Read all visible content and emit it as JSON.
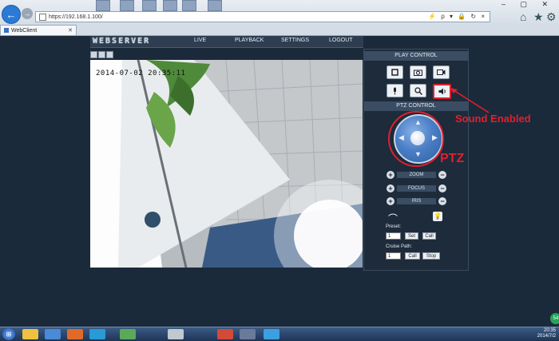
{
  "browser": {
    "url": "https://192.168.1.100/",
    "tab_title": "WebClient",
    "addr_tools": "⚡ ρ ▾ 🔒 ↻ ×",
    "window_controls": "– ▢ ✕"
  },
  "app": {
    "brand": "WEBSERVER",
    "menu": [
      "LIVE",
      "PLAYBACK",
      "SETTINGS",
      "LOGOUT"
    ]
  },
  "video": {
    "timestamp": "2014-07-02 20:35:11"
  },
  "panel": {
    "play_control_heading": "PLAY CONTROL",
    "ptz_control_heading": "PTZ CONTROL",
    "adjust_labels": [
      "ZOOM",
      "FOCUS",
      "IRIS"
    ],
    "preset_label": "Preset:",
    "preset_value": "1",
    "set_label": "Set",
    "call_label": "Call",
    "cruise_label": "Cruise Path:",
    "cruise_value": "1",
    "stop_label": "Stop"
  },
  "annotations": {
    "sound": "Sound Enabled",
    "ptz": "PTZ",
    "color": "#e0202e"
  },
  "taskbar": {
    "clock_time": "20:35",
    "clock_date": "2014/7/2",
    "badge": "54"
  },
  "icons": {
    "stop": "stop-icon",
    "snapshot": "camera-icon",
    "record": "record-icon",
    "talk": "microphone-icon",
    "zoom": "magnifier-icon",
    "sound": "speaker-icon"
  }
}
